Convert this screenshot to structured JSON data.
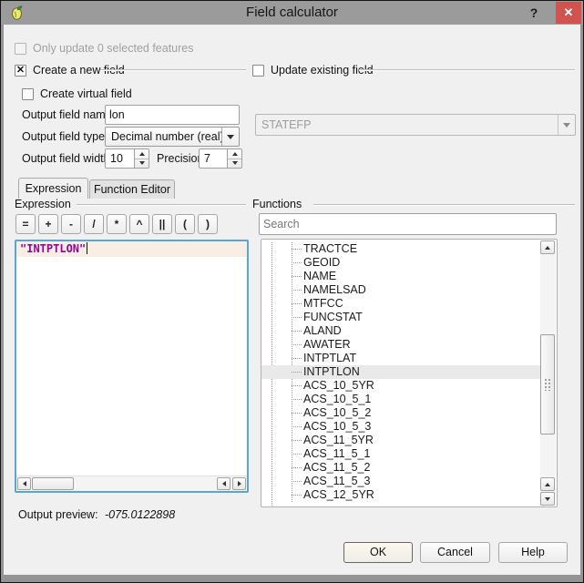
{
  "titlebar": {
    "title": "Field calculator",
    "help": "?",
    "close": "✕"
  },
  "options": {
    "only_update_label": "Only update 0 selected features"
  },
  "create_field": {
    "create_new_label": "Create a new field",
    "create_new_checked": "✕",
    "create_virtual_label": "Create virtual field",
    "output_name_label": "Output field name",
    "output_name_value": "lon",
    "output_type_label": "Output field type",
    "output_type_value": "Decimal number (real)",
    "output_width_label": "Output field width",
    "output_width_value": "10",
    "precision_label": "Precision",
    "precision_value": "7"
  },
  "update_field": {
    "label": "Update existing field",
    "field_value": "STATEFP"
  },
  "tabs": {
    "expression": "Expression",
    "function_editor": "Function Editor"
  },
  "expression": {
    "group_label": "Expression",
    "operators": [
      "=",
      "+",
      "-",
      "/",
      "*",
      "^",
      "||",
      "(",
      ")"
    ],
    "code": "\"INTPTLON\""
  },
  "functions": {
    "group_label": "Functions",
    "search_placeholder": "Search",
    "selected": "INTPTLON",
    "fields": [
      "TRACTCE",
      "GEOID",
      "NAME",
      "NAMELSAD",
      "MTFCC",
      "FUNCSTAT",
      "ALAND",
      "AWATER",
      "INTPTLAT",
      "INTPTLON",
      "ACS_10_5YR",
      "ACS_10_5_1",
      "ACS_10_5_2",
      "ACS_10_5_3",
      "ACS_11_5YR",
      "ACS_11_5_1",
      "ACS_11_5_2",
      "ACS_11_5_3",
      "ACS_12_5YR"
    ]
  },
  "preview": {
    "label": "Output preview:",
    "value": "-075.0122898"
  },
  "actions": {
    "ok": "OK",
    "cancel": "Cancel",
    "help": "Help"
  },
  "colors": {
    "titlebar": "#9b9b9b",
    "close_button": "#d0534f",
    "editor_border": "#58a6d6",
    "expression_text": "#990099",
    "current_line_bg": "#f8eee3",
    "selected_row_bg": "#e9e9e9",
    "client_bg": "#f0f0f0"
  }
}
